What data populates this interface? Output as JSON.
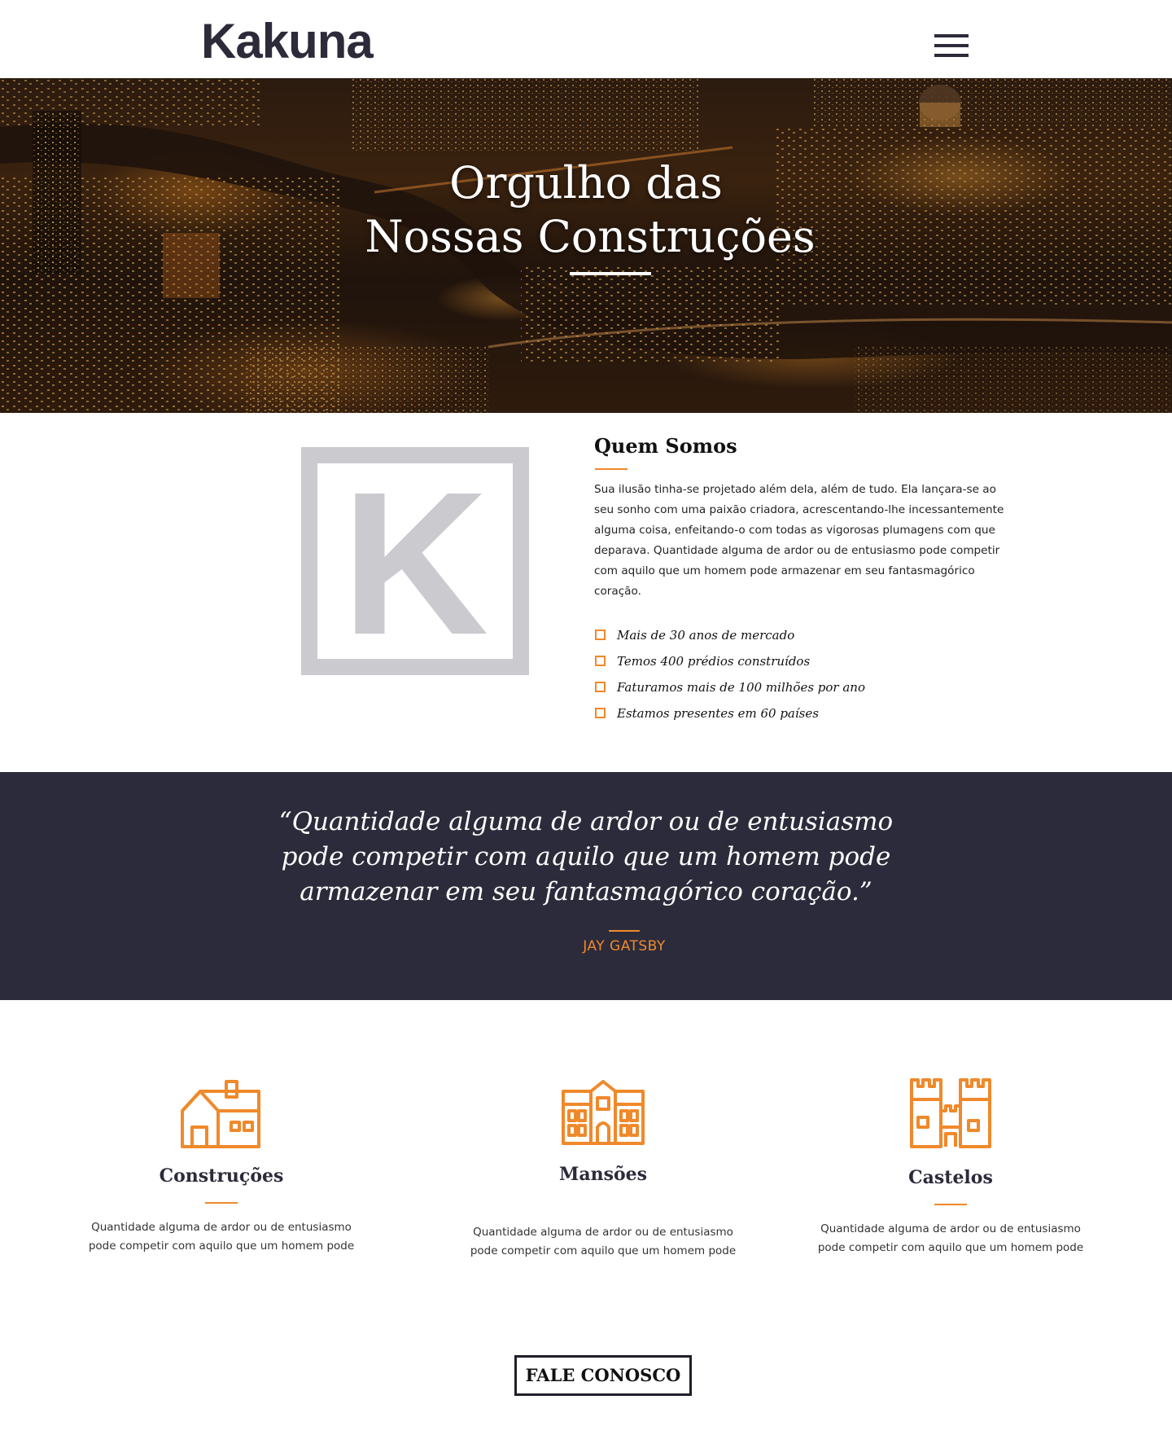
{
  "header": {
    "logo": "Kakuna",
    "menu_icon": "hamburger-menu-icon"
  },
  "hero": {
    "title_line1": "Orgulho das",
    "title_line2": "Nossas Construções"
  },
  "about": {
    "title": "Quem Somos",
    "logo_letter": "K",
    "text": "Sua ilusão tinha-se projetado além dela, além de tudo. Ela lançara-se ao seu sonho com uma paixão criadora, acrescentando-lhe incessantemente alguma coisa, enfeitando-o com todas as vigorosas plumagens com que deparava. Quantidade alguma de ardor ou de entusiasmo pode competir com aquilo que um homem pode armazenar em seu fantasmagórico coração.",
    "list": [
      "Mais de 30 anos de mercado",
      "Temos 400 prédios construídos",
      "Faturamos mais de 100 milhões por ano",
      "Estamos presentes em 60 países"
    ]
  },
  "quote": {
    "text": "“Quantidade alguma de ardor ou de entusiasmo pode competir com aquilo que um homem pode armazenar em seu fantasmagórico coração.”",
    "author": "JAY GATSBY"
  },
  "services": [
    {
      "icon": "house-icon",
      "title": "Construções",
      "text": "Quantidade alguma de ardor ou de entusiasmo pode competir com aquilo que um homem pode"
    },
    {
      "icon": "mansion-icon",
      "title": "Mansões",
      "text": "Quantidade alguma de ardor ou de entusiasmo pode competir com aquilo que um homem pode"
    },
    {
      "icon": "castle-icon",
      "title": "Castelos",
      "text": "Quantidade alguma de ardor ou de entusiasmo pode competir com aquilo que um homem pode"
    }
  ],
  "cta": {
    "label": "FALE CONOSCO"
  },
  "colors": {
    "accent": "#f0892b",
    "dark": "#2c2b3b",
    "logo_gray": "#cacacf"
  }
}
